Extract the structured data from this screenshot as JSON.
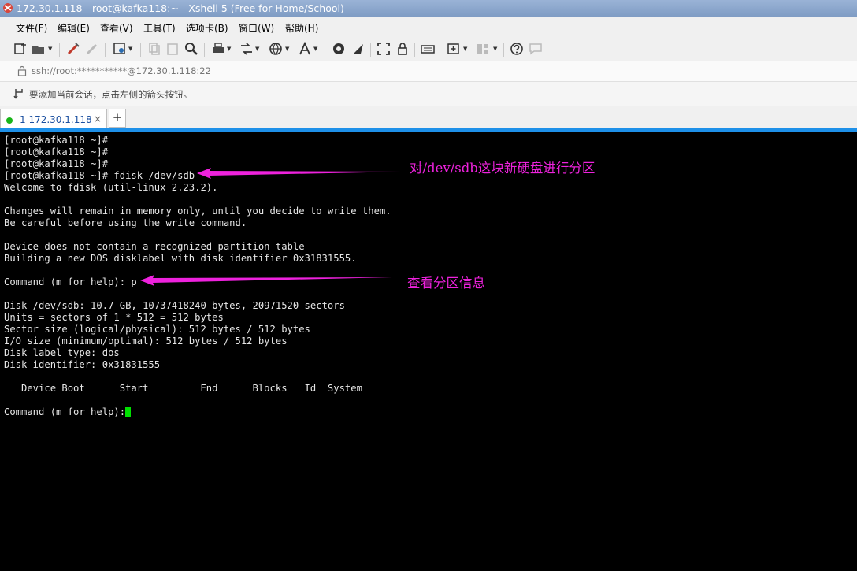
{
  "window": {
    "title": "172.30.1.118 - root@kafka118:~ - Xshell 5 (Free for Home/School)"
  },
  "menu": [
    {
      "label": "文件(F)"
    },
    {
      "label": "编辑(E)"
    },
    {
      "label": "查看(V)"
    },
    {
      "label": "工具(T)"
    },
    {
      "label": "选项卡(B)"
    },
    {
      "label": "窗口(W)"
    },
    {
      "label": "帮助(H)"
    }
  ],
  "address": {
    "text": "ssh://root:***********@172.30.1.118:22"
  },
  "infobar": {
    "text": "要添加当前会话，点击左侧的箭头按钮。"
  },
  "tabs": [
    {
      "number": "1",
      "label": " 172.30.1.118",
      "close": "×"
    }
  ],
  "new_tab": "+",
  "terminal": {
    "lines": [
      "[root@kafka118 ~]#",
      "[root@kafka118 ~]#",
      "[root@kafka118 ~]#",
      "[root@kafka118 ~]# fdisk /dev/sdb",
      "Welcome to fdisk (util-linux 2.23.2).",
      "",
      "Changes will remain in memory only, until you decide to write them.",
      "Be careful before using the write command.",
      "",
      "Device does not contain a recognized partition table",
      "Building a new DOS disklabel with disk identifier 0x31831555.",
      "",
      "Command (m for help): p",
      "",
      "Disk /dev/sdb: 10.7 GB, 10737418240 bytes, 20971520 sectors",
      "Units = sectors of 1 * 512 = 512 bytes",
      "Sector size (logical/physical): 512 bytes / 512 bytes",
      "I/O size (minimum/optimal): 512 bytes / 512 bytes",
      "Disk label type: dos",
      "Disk identifier: 0x31831555",
      "",
      "   Device Boot      Start         End      Blocks   Id  System",
      "",
      "Command (m for help): "
    ]
  },
  "annotations": [
    {
      "text": "对/dev/sdb这块新硬盘进行分区"
    },
    {
      "text": "查看分区信息"
    }
  ],
  "colors": {
    "annotation": "#ee22dd",
    "cursor": "#00e000",
    "tab_accent": "#1e90e8"
  }
}
